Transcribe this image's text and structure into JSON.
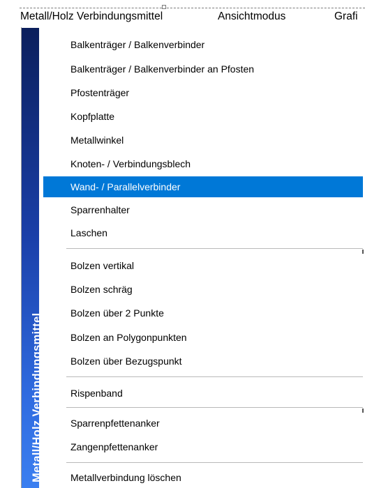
{
  "menubar": {
    "items": [
      {
        "label": "Metall/Holz Verbindungsmittel"
      },
      {
        "label": "Ansichtmodus"
      },
      {
        "label": "Grafi"
      }
    ]
  },
  "band": {
    "text": "Metall/Holz Verbindungsmittel",
    "color_top": "#0b1f5c",
    "color_bottom": "#3b7ff0"
  },
  "menu": {
    "selected_color": "#0078d7",
    "items": [
      {
        "label": "Balkenträger / Balkenverbinder"
      },
      {
        "label": "Balkenträger / Balkenverbinder an Pfosten"
      },
      {
        "label": "Pfostenträger"
      },
      {
        "label": "Kopfplatte"
      },
      {
        "label": "Metallwinkel"
      },
      {
        "label": "Knoten- / Verbindungsblech"
      },
      {
        "label": "Wand- / Parallelverbinder",
        "selected": true
      },
      {
        "label": "Sparrenhalter"
      },
      {
        "label": "Laschen"
      },
      {
        "label": "Bolzen vertikal"
      },
      {
        "label": "Bolzen schräg"
      },
      {
        "label": "Bolzen über 2 Punkte"
      },
      {
        "label": "Bolzen an Polygonpunkten"
      },
      {
        "label": "Bolzen über Bezugspunkt"
      },
      {
        "label": "Rispenband"
      },
      {
        "label": "Sparrenpfettenanker"
      },
      {
        "label": "Zangenpfettenanker"
      },
      {
        "label": "Metallverbindung löschen"
      }
    ]
  }
}
